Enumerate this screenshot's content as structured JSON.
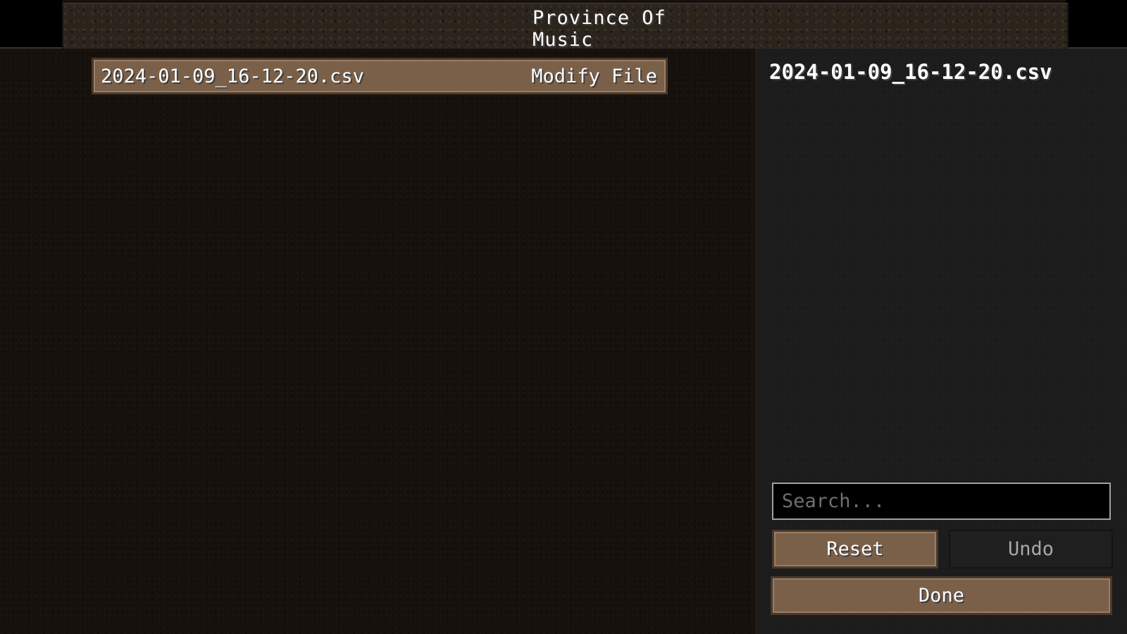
{
  "header": {
    "tabs": [
      {
        "label": "Province Of Music",
        "active": true
      }
    ]
  },
  "file_list": {
    "items": [
      {
        "name": "2024-01-09_16-12-20.csv",
        "action_label": "Modify File"
      }
    ]
  },
  "side_panel": {
    "selected_file": "2024-01-09_16-12-20.csv",
    "search": {
      "value": "",
      "placeholder": "Search..."
    },
    "reset_label": "Reset",
    "undo_label": "Undo",
    "done_label": "Done"
  },
  "colors": {
    "button_brown": "#7b6049",
    "panel_bg": "#1c1c1c",
    "list_bg": "#16110d",
    "text": "#ffffff"
  }
}
